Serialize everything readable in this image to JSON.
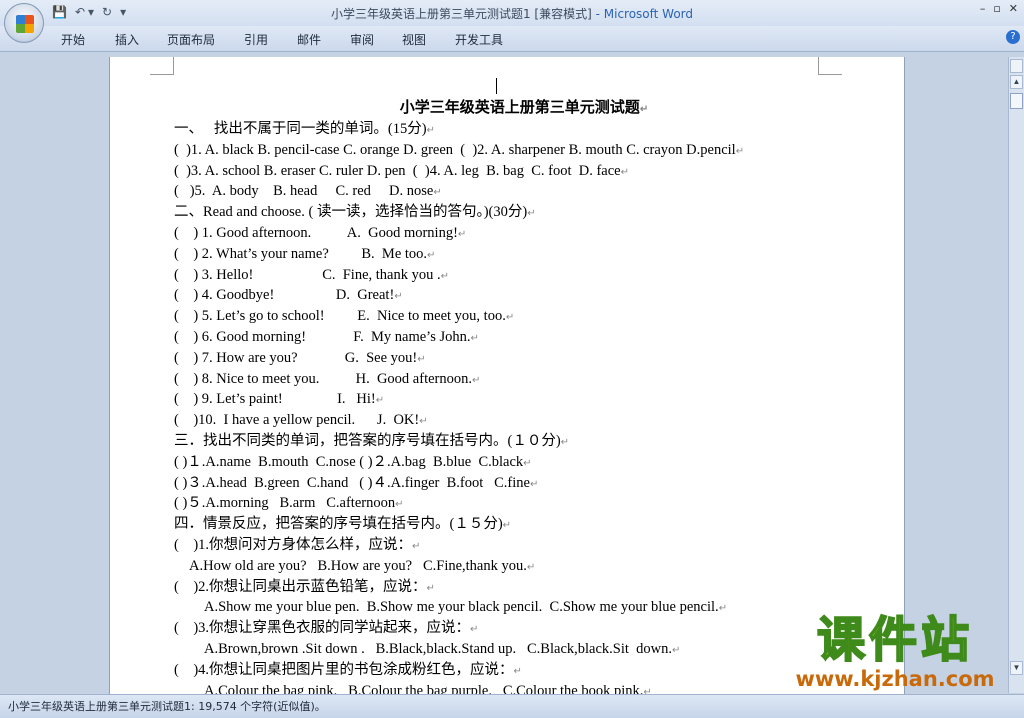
{
  "window": {
    "title": "小学三年级英语上册第三单元测试题1 [兼容模式]",
    "app": " - Microsoft Word",
    "controls": [
      "–",
      "▫",
      "✕"
    ]
  },
  "qat": {
    "save": "💾",
    "undo": "↶ ▾",
    "redo": "↻",
    "more": "▾"
  },
  "ribbon": {
    "tabs": [
      "开始",
      "插入",
      "页面布局",
      "引用",
      "邮件",
      "审阅",
      "视图",
      "开发工具"
    ],
    "help": "?"
  },
  "document": {
    "title": "小学三年级英语上册第三单元测试题",
    "lines": [
      {
        "t": "一、   找出不属于同一类的单词。(15分)",
        "i": 0
      },
      {
        "t": "(  )1. A. black B. pencil-case C. orange D. green  (  )2. A. sharpener B. mouth C. crayon D.pencil",
        "i": 0
      },
      {
        "t": "(  )3. A. school B. eraser C. ruler D. pen  (  )4. A. leg  B. bag  C. foot  D. face",
        "i": 0
      },
      {
        "t": "(   )5.  A. body    B. head     C. red     D. nose",
        "i": 0
      },
      {
        "t": "二、Read and choose. ( 读一读，选择恰当的答句。)(30分)",
        "i": 0
      },
      {
        "t": "(    ) 1. Good afternoon.          A.  Good morning!",
        "i": 0
      },
      {
        "t": "(    ) 2. What’s your name?         B.  Me too.",
        "i": 0
      },
      {
        "t": "(    ) 3. Hello!                   C.  Fine, thank you .",
        "i": 0
      },
      {
        "t": "(    ) 4. Goodbye!                 D.  Great!",
        "i": 0
      },
      {
        "t": "(    ) 5. Let’s go to school!         E.  Nice to meet you, too.",
        "i": 0
      },
      {
        "t": "(    ) 6. Good morning!             F.  My name’s John.",
        "i": 0
      },
      {
        "t": "(    ) 7. How are you?             G.  See you!",
        "i": 0
      },
      {
        "t": "(    ) 8. Nice to meet you.          H.  Good afternoon.",
        "i": 0
      },
      {
        "t": "(    ) 9. Let’s paint!               I.   Hi!",
        "i": 0
      },
      {
        "t": "(    )10.  I have a yellow pencil.      J.  OK!",
        "i": 0
      },
      {
        "t": "三．找出不同类的单词，把答案的序号填在括号内。(１０分)",
        "i": 0
      },
      {
        "t": "( )１.A.name  B.mouth  C.nose ( )２.A.bag  B.blue  C.black",
        "i": 0
      },
      {
        "t": "( )３.A.head  B.green  C.hand   ( )４.A.finger  B.foot   C.fine",
        "i": 0
      },
      {
        "t": "( )５.A.morning   B.arm   C.afternoon",
        "i": 0
      },
      {
        "t": "四．情景反应，把答案的序号填在括号内。(１５分)",
        "i": 0
      },
      {
        "t": "(    )1.你想问对方身体怎么样，应说：",
        "i": 0
      },
      {
        "t": "A.How old are you?   B.How are you?   C.Fine,thank you.",
        "i": 1
      },
      {
        "t": "(    )2.你想让同桌出示蓝色铅笔，应说：",
        "i": 0
      },
      {
        "t": "A.Show me your blue pen.  B.Show me your black pencil.  C.Show me your blue pencil.",
        "i": 2
      },
      {
        "t": "(    )3.你想让穿黑色衣服的同学站起来，应说：",
        "i": 0
      },
      {
        "t": "A.Brown,brown .Sit down .   B.Black,black.Stand up.   C.Black,black.Sit  down.",
        "i": 2
      },
      {
        "t": "(    )4.你想让同桌把图片里的书包涂成粉红色，应说：",
        "i": 0
      },
      {
        "t": "A.Colour the bag pink.   B.Colour the bag purple.   C.Colour the book pink.",
        "i": 2
      }
    ],
    "paragraph_mark": "↵"
  },
  "status": {
    "text": "小学三年级英语上册第三单元测试题1: 19,574 个字符(近似值)。"
  },
  "watermark": {
    "text": "课件站",
    "url": "www.kjzhan.com"
  }
}
